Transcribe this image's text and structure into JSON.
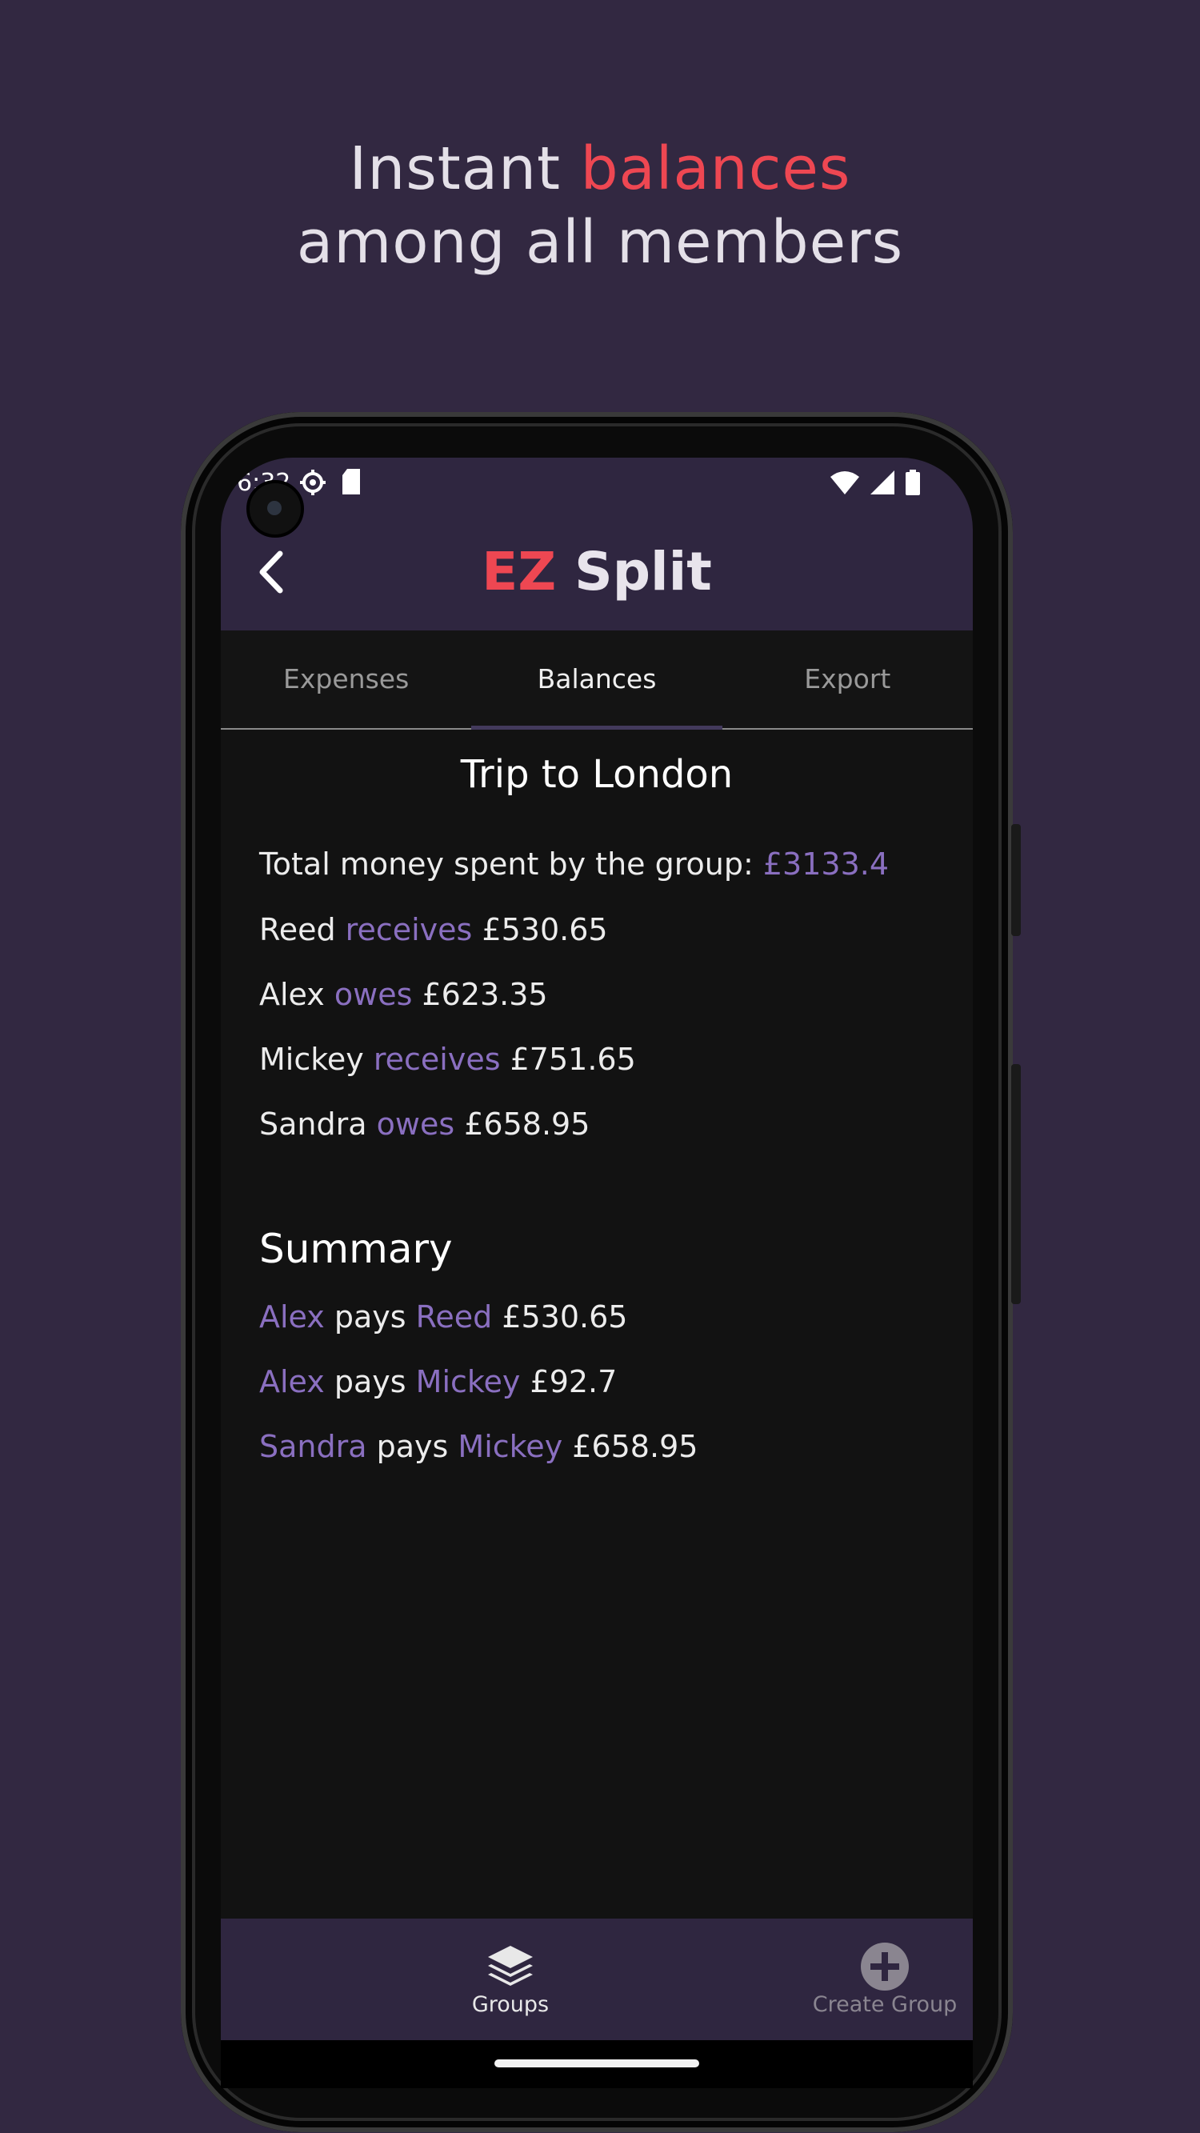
{
  "headline": {
    "line1_prefix": "Instant ",
    "line1_accent": "balances",
    "line2": "among all members"
  },
  "status_bar": {
    "time": "6:32",
    "left_icons": [
      "settings-icon",
      "sd-card-icon"
    ],
    "right_icons": [
      "wifi-icon",
      "signal-icon",
      "battery-icon"
    ]
  },
  "app_bar": {
    "title_accent": "EZ",
    "title_rest": " Split",
    "back_icon": "chevron-left-icon"
  },
  "tabs": [
    {
      "label": "Expenses",
      "active": false
    },
    {
      "label": "Balances",
      "active": true
    },
    {
      "label": "Export",
      "active": false
    }
  ],
  "group": {
    "title": "Trip to London",
    "total_prefix": "Total money spent by the group: ",
    "total_value": "£3133.4"
  },
  "balances": [
    {
      "name": "Reed",
      "verb": "receives",
      "amount": "£530.65"
    },
    {
      "name": "Alex",
      "verb": "owes",
      "amount": "£623.35"
    },
    {
      "name": "Mickey",
      "verb": "receives",
      "amount": "£751.65"
    },
    {
      "name": "Sandra",
      "verb": "owes",
      "amount": "£658.95"
    }
  ],
  "summary": {
    "title": "Summary",
    "items": [
      {
        "from": "Alex",
        "verb": "pays",
        "to": "Reed",
        "amount": "£530.65"
      },
      {
        "from": "Alex",
        "verb": "pays",
        "to": "Mickey",
        "amount": "£92.7"
      },
      {
        "from": "Sandra",
        "verb": "pays",
        "to": "Mickey",
        "amount": "£658.95"
      }
    ]
  },
  "bottom_nav": [
    {
      "label": "Groups",
      "icon": "layers-icon",
      "active": true
    },
    {
      "label": "Create Group",
      "icon": "plus-circle-icon",
      "active": false
    }
  ],
  "colors": {
    "background": "#322841",
    "accent_red": "#ee4752",
    "highlight_purple": "#8a6fc0",
    "app_bar": "#2f2640",
    "content_bg": "#121212"
  }
}
